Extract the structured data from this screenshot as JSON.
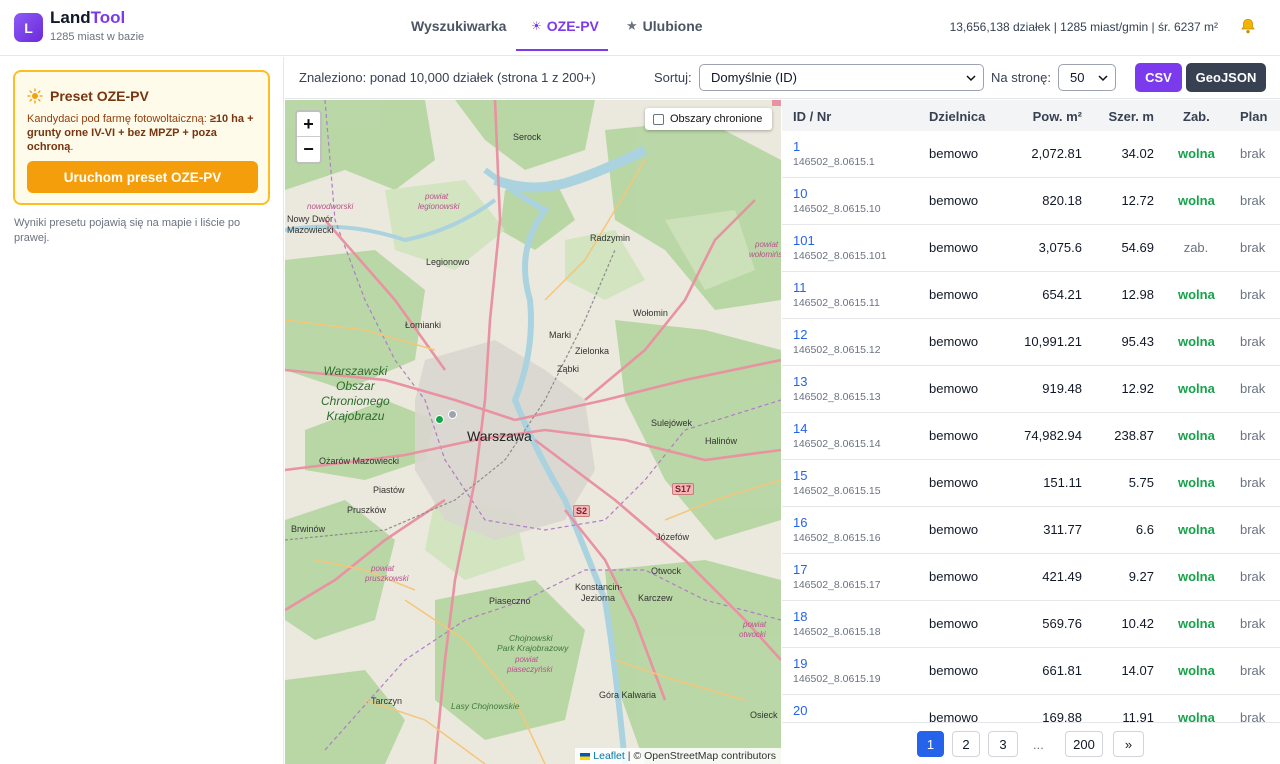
{
  "brand": {
    "logo_letter": "L",
    "name_part1": "Land",
    "name_part2": "Tool",
    "subtitle": "1285 miast w bazie"
  },
  "nav": {
    "tabs": [
      {
        "label": "Wyszukiwarka",
        "icon": ""
      },
      {
        "label": "OZE-PV",
        "icon": "☀"
      },
      {
        "label": "Ulubione",
        "icon": "★"
      }
    ],
    "active_tab": "OZE-PV"
  },
  "header_stats": "13,656,138 działek | 1285 miast/gmin | śr. 6237 m²",
  "preset": {
    "title": "Preset OZE-PV",
    "desc_intro": "Kandydaci pod farmę fotowoltaiczną:",
    "desc_criteria": "≥10 ha + grunty orne IV-VI + bez MPZP + poza ochroną",
    "desc_end": ".",
    "button": "Uruchom preset OZE-PV",
    "note": "Wyniki presetu pojawią się na mapie i liście po prawej."
  },
  "toolbar": {
    "found": "Znaleziono: ponad 10,000 działek (strona 1 z 200+)",
    "sort_label": "Sortuj:",
    "sort_value": "Domyślnie (ID)",
    "perpage_label": "Na stronę:",
    "perpage_value": "50",
    "csv": "CSV",
    "geojson": "GeoJSON"
  },
  "map": {
    "zoom_in": "+",
    "zoom_out": "−",
    "protected_toggle": "Obszary chronione",
    "attribution_leaflet": "Leaflet",
    "attribution_rest": "| © OpenStreetMap contributors",
    "labels": {
      "serock": "Serock",
      "nowy_dwor": "Nowy Dwór",
      "mazowiecki": "Mazowiecki",
      "legionowo": "Legionowo",
      "radzymin": "Radzymin",
      "lomianki": "Łomianki",
      "marki": "Marki",
      "wolomin": "Wołomin",
      "zielonka": "Zielonka",
      "zabki": "Ząbki",
      "sulejowek": "Sulejówek",
      "halinow": "Halinów",
      "warszawa": "Warszawa",
      "ozarow": "Ożarów Mazowiecki",
      "piastow": "Piastów",
      "pruszkow": "Pruszków",
      "brwinow": "Brwinów",
      "jozefow": "Józefów",
      "otwock": "Otwock",
      "konstancin": "Konstancin-",
      "jeziorna": "Jeziorna",
      "karczew": "Karczew",
      "piaseczno": "Piaseczno",
      "gora_kalwaria": "Góra Kalwaria",
      "tarczyn": "Tarczyn",
      "osieck": "Osieck",
      "reserve": "Warszawski\nObszar\nChronionego\nKrajobrazu",
      "legionowski_1": "powiat",
      "legionowski_2": "legionowski",
      "nowodworski": "nowodworski",
      "wolominski_1": "powiat",
      "wolominski_2": "wołomiński",
      "pruszkowski_1": "powiat",
      "pruszkowski_2": "pruszkowski",
      "piaseczynski_1": "powiat",
      "piaseczynski_2": "piaseczyński",
      "otwocki_1": "powiat",
      "otwocki_2": "otwocki",
      "chojnowski_1": "Chojnowski",
      "chojnowski_2": "Park Krajobrazowy",
      "lasy": "Lasy Chojnowskie",
      "s17": "S17",
      "s2": "S2"
    }
  },
  "table": {
    "headers": [
      "ID / Nr",
      "Dzielnica",
      "Pow. m²",
      "Szer. m",
      "Zab.",
      "Plan"
    ],
    "rows": [
      {
        "id": "1",
        "nr": "146502_8.0615.1",
        "district": "bemowo",
        "area": "2,072.81",
        "width": "34.02",
        "zab": "wolna",
        "plan": "brak"
      },
      {
        "id": "10",
        "nr": "146502_8.0615.10",
        "district": "bemowo",
        "area": "820.18",
        "width": "12.72",
        "zab": "wolna",
        "plan": "brak"
      },
      {
        "id": "101",
        "nr": "146502_8.0615.101",
        "district": "bemowo",
        "area": "3,075.6",
        "width": "54.69",
        "zab": "zab.",
        "plan": "brak"
      },
      {
        "id": "11",
        "nr": "146502_8.0615.11",
        "district": "bemowo",
        "area": "654.21",
        "width": "12.98",
        "zab": "wolna",
        "plan": "brak"
      },
      {
        "id": "12",
        "nr": "146502_8.0615.12",
        "district": "bemowo",
        "area": "10,991.21",
        "width": "95.43",
        "zab": "wolna",
        "plan": "brak"
      },
      {
        "id": "13",
        "nr": "146502_8.0615.13",
        "district": "bemowo",
        "area": "919.48",
        "width": "12.92",
        "zab": "wolna",
        "plan": "brak"
      },
      {
        "id": "14",
        "nr": "146502_8.0615.14",
        "district": "bemowo",
        "area": "74,982.94",
        "width": "238.87",
        "zab": "wolna",
        "plan": "brak"
      },
      {
        "id": "15",
        "nr": "146502_8.0615.15",
        "district": "bemowo",
        "area": "151.11",
        "width": "5.75",
        "zab": "wolna",
        "plan": "brak"
      },
      {
        "id": "16",
        "nr": "146502_8.0615.16",
        "district": "bemowo",
        "area": "311.77",
        "width": "6.6",
        "zab": "wolna",
        "plan": "brak"
      },
      {
        "id": "17",
        "nr": "146502_8.0615.17",
        "district": "bemowo",
        "area": "421.49",
        "width": "9.27",
        "zab": "wolna",
        "plan": "brak"
      },
      {
        "id": "18",
        "nr": "146502_8.0615.18",
        "district": "bemowo",
        "area": "569.76",
        "width": "10.42",
        "zab": "wolna",
        "plan": "brak"
      },
      {
        "id": "19",
        "nr": "146502_8.0615.19",
        "district": "bemowo",
        "area": "661.81",
        "width": "14.07",
        "zab": "wolna",
        "plan": "brak"
      },
      {
        "id": "20",
        "nr": "",
        "district": "bemowo",
        "area": "169.88",
        "width": "11.91",
        "zab": "wolna",
        "plan": "brak"
      }
    ]
  },
  "pagination": {
    "pages": [
      "1",
      "2",
      "3"
    ],
    "ellipsis": "...",
    "last": "200",
    "next": "»",
    "current": "1"
  },
  "colors": {
    "accent": "#7c3aed",
    "preset": "#f59e0b",
    "free": "#16a34a",
    "link": "#2563eb"
  }
}
